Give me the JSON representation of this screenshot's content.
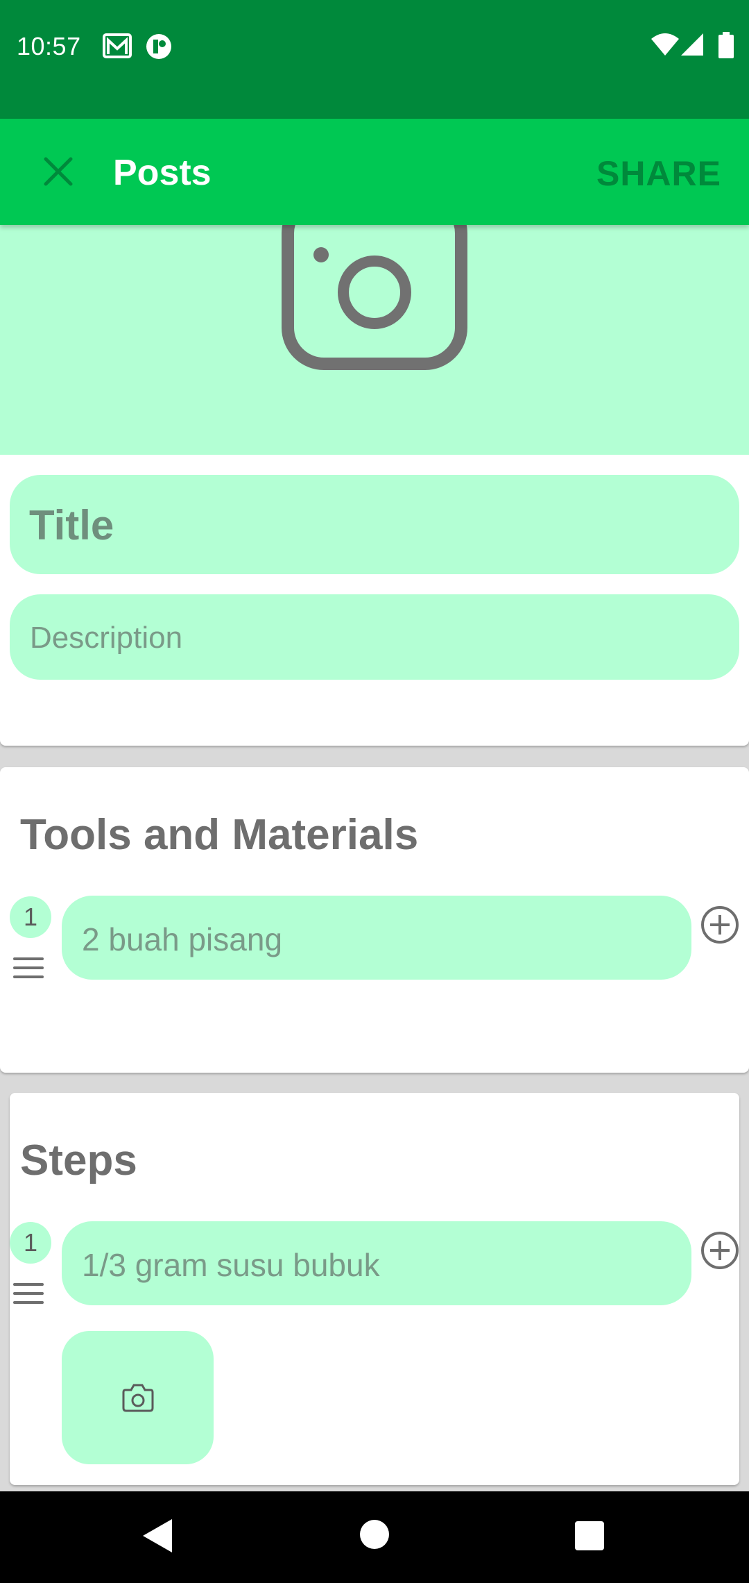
{
  "status_bar": {
    "time": "10:57",
    "icons": [
      "gmail-icon",
      "notification-icon",
      "wifi-icon",
      "signal-icon",
      "battery-icon"
    ]
  },
  "app_bar": {
    "title": "Posts",
    "share_label": "SHARE",
    "close_icon": "close-icon"
  },
  "post_form": {
    "cover_icon": "camera-icon",
    "title_placeholder": "Title",
    "description_placeholder": "Description"
  },
  "tools_section": {
    "heading": "Tools and Materials",
    "items": [
      {
        "number": "1",
        "value": "2 buah pisang"
      }
    ]
  },
  "steps_section": {
    "heading": "Steps",
    "items": [
      {
        "number": "1",
        "value": "1/3 gram susu bubuk"
      }
    ]
  },
  "nav_bar": {
    "buttons": [
      "back-icon",
      "home-icon",
      "recents-icon"
    ]
  },
  "colors": {
    "status_bar": "#00893b",
    "app_bar": "#00c853",
    "field_bg": "#b3ffd4",
    "share_text": "#00893b"
  }
}
